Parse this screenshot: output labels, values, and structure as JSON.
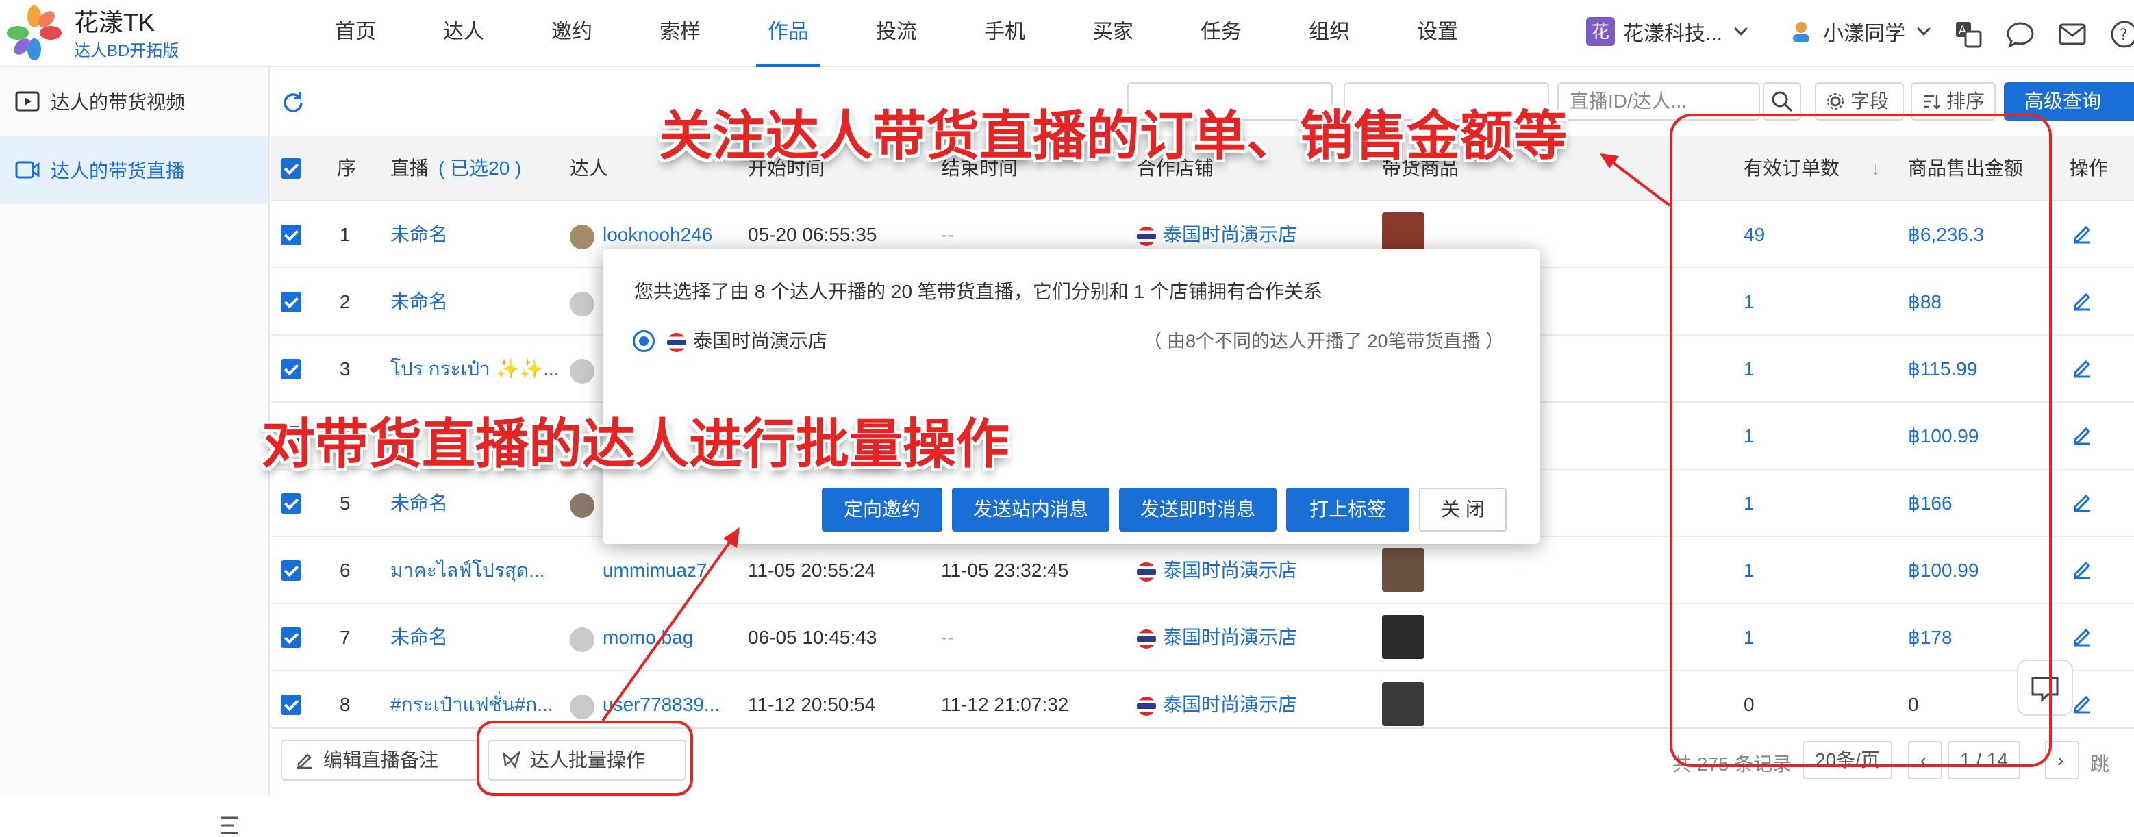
{
  "brand": {
    "name": "花漾TK",
    "subtitle": "达人BD开拓版"
  },
  "nav": [
    "首页",
    "达人",
    "邀约",
    "索样",
    "作品",
    "投流",
    "手机",
    "买家",
    "任务",
    "组织",
    "设置"
  ],
  "nav_active": "作品",
  "org": {
    "badge": "花",
    "name": "花漾科技..."
  },
  "user": {
    "name": "小漾同学"
  },
  "sidebar": [
    {
      "label": "达人的带货视频",
      "active": false
    },
    {
      "label": "达人的带货直播",
      "active": true
    }
  ],
  "toolbar": {
    "select1": "",
    "select2": "",
    "search_placeholder": "直播ID/达人...",
    "field_btn": "字段",
    "sort_btn": "排序",
    "advanced_btn": "高级查询"
  },
  "table": {
    "headers": {
      "index": "序",
      "live": "直播",
      "selected": "( 已选20 )",
      "creator": "达人",
      "start": "开始时间",
      "end": "结束时间",
      "shop": "合作店铺",
      "products": "带货商品",
      "orders": "有效订单数",
      "amount": "商品售出金额",
      "ops": "操作"
    },
    "rows": [
      {
        "index": "1",
        "live": "未命名",
        "creator": "looknooh246",
        "start": "05-20 06:55:35",
        "end": "--",
        "shop": "泰国时尚演示店",
        "orders": "49",
        "amount": "฿6,236.3",
        "product_color": "#8a3a2a"
      },
      {
        "index": "2",
        "live": "未命名",
        "creator": "",
        "start": "",
        "end": "",
        "shop": "",
        "orders": "1",
        "amount": "฿88",
        "product_color": ""
      },
      {
        "index": "3",
        "live": "โปร กระเป๋า ✨✨...",
        "creator": "",
        "start": "",
        "end": "",
        "shop": "",
        "orders": "1",
        "amount": "฿115.99",
        "product_color": ""
      },
      {
        "index": "4",
        "live": "",
        "creator": "",
        "start": "",
        "end": "",
        "shop": "",
        "orders": "1",
        "amount": "฿100.99",
        "product_color": ""
      },
      {
        "index": "5",
        "live": "未命名",
        "creator": "",
        "start": "",
        "end": "",
        "shop": "",
        "orders": "1",
        "amount": "฿166",
        "product_color": ""
      },
      {
        "index": "6",
        "live": "มาคะไลฟ์โปรสุด...",
        "creator": "ummimuaz7",
        "start": "11-05 20:55:24",
        "end": "11-05 23:32:45",
        "shop": "泰国时尚演示店",
        "orders": "1",
        "amount": "฿100.99",
        "product_color": "#6b5040"
      },
      {
        "index": "7",
        "live": "未命名",
        "creator": "momo.bag",
        "start": "06-05 10:45:43",
        "end": "--",
        "shop": "泰国时尚演示店",
        "orders": "1",
        "amount": "฿178",
        "product_color": "#2b2b2b"
      },
      {
        "index": "8",
        "live": "#กระเป๋าแฟชั่น#ก...",
        "creator": "user778839...",
        "start": "11-12 20:50:54",
        "end": "11-12 21:07:32",
        "shop": "泰国时尚演示店",
        "orders": "0",
        "amount": "0",
        "product_color": "#3a3a3a"
      }
    ]
  },
  "footer": {
    "edit_btn": "编辑直播备注",
    "batch_btn": "达人批量操作",
    "total": "共 275 条记录",
    "page_size": "20条/页",
    "page": "1 / 14",
    "jump": "跳"
  },
  "modal": {
    "message": "您共选择了由 8 个达人开播的 20 笔带货直播，它们分别和 1 个店铺拥有合作关系",
    "shop_option": "泰国时尚演示店",
    "shop_note": "（ 由8个不同的达人开播了 20笔带货直播 ）",
    "buttons": [
      "定向邀约",
      "发送站内消息",
      "发送即时消息",
      "打上标签"
    ],
    "close": "关 闭"
  },
  "callouts": {
    "top": "关注达人带货直播的订单、销售金额等",
    "middle": "对带货直播的达人进行批量操作"
  },
  "colors": {
    "accent": "#1a6fd6",
    "callout": "#e52424",
    "selected_bg": "#e7f0fd"
  }
}
